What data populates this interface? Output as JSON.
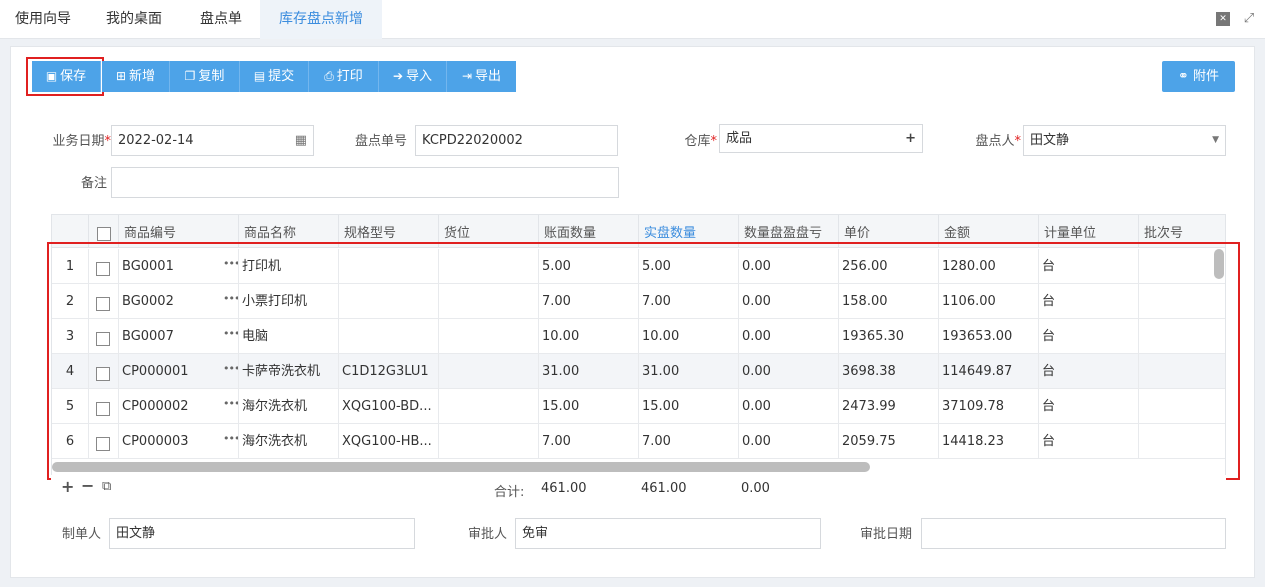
{
  "tabs": [
    {
      "label": "使用向导"
    },
    {
      "label": "我的桌面"
    },
    {
      "label": "盘点单"
    },
    {
      "label": "库存盘点新增"
    }
  ],
  "window_icons": {
    "close": "✕",
    "fullscreen": "⤢"
  },
  "toolbar": {
    "save": "保存",
    "add": "新增",
    "copy": "复制",
    "submit": "提交",
    "print": "打印",
    "import": "导入",
    "export": "导出",
    "attachment": "附件"
  },
  "form": {
    "biz_date_label": "业务日期",
    "biz_date_value": "2022-02-14",
    "doc_no_label": "盘点单号",
    "doc_no_value": "KCPD22020002",
    "warehouse_label": "仓库",
    "warehouse_value": "成品",
    "counter_label": "盘点人",
    "counter_value": "田文静",
    "remark_label": "备注",
    "remark_value": ""
  },
  "table": {
    "headers": [
      "商品编号",
      "商品名称",
      "规格型号",
      "货位",
      "账面数量",
      "实盘数量",
      "数量盘盈盘亏",
      "单价",
      "金额",
      "计量单位",
      "批次号"
    ],
    "rows": [
      {
        "no": "1",
        "code": "BG0001",
        "name": "打印机",
        "spec": "",
        "loc": "",
        "book_qty": "5.00",
        "real_qty": "5.00",
        "diff": "0.00",
        "price": "256.00",
        "amount": "1280.00",
        "unit": "台",
        "batch": ""
      },
      {
        "no": "2",
        "code": "BG0002",
        "name": "小票打印机",
        "spec": "",
        "loc": "",
        "book_qty": "7.00",
        "real_qty": "7.00",
        "diff": "0.00",
        "price": "158.00",
        "amount": "1106.00",
        "unit": "台",
        "batch": ""
      },
      {
        "no": "3",
        "code": "BG0007",
        "name": "电脑",
        "spec": "",
        "loc": "",
        "book_qty": "10.00",
        "real_qty": "10.00",
        "diff": "0.00",
        "price": "19365.30",
        "amount": "193653.00",
        "unit": "台",
        "batch": ""
      },
      {
        "no": "4",
        "code": "CP000001",
        "name": "卡萨帝洗衣机",
        "spec": "C1D12G3LU1",
        "loc": "",
        "book_qty": "31.00",
        "real_qty": "31.00",
        "diff": "0.00",
        "price": "3698.38",
        "amount": "114649.87",
        "unit": "台",
        "batch": ""
      },
      {
        "no": "5",
        "code": "CP000002",
        "name": "海尔洗衣机",
        "spec": "XQG100-BD...",
        "loc": "",
        "book_qty": "15.00",
        "real_qty": "15.00",
        "diff": "0.00",
        "price": "2473.99",
        "amount": "37109.78",
        "unit": "台",
        "batch": ""
      },
      {
        "no": "6",
        "code": "CP000003",
        "name": "海尔洗衣机",
        "spec": "XQG100-HB...",
        "loc": "",
        "book_qty": "7.00",
        "real_qty": "7.00",
        "diff": "0.00",
        "price": "2059.75",
        "amount": "14418.23",
        "unit": "台",
        "batch": ""
      }
    ],
    "total_label": "合计:",
    "total_book_qty": "461.00",
    "total_real_qty": "461.00",
    "total_diff": "0.00"
  },
  "bottom": {
    "maker_label": "制单人",
    "maker_value": "田文静",
    "approver_label": "审批人",
    "approver_value": "免审",
    "approve_date_label": "审批日期",
    "approve_date_value": ""
  },
  "colors": {
    "accent": "#4da3e8",
    "highlight": "#e02020",
    "active_tab_text": "#3c8dde"
  }
}
